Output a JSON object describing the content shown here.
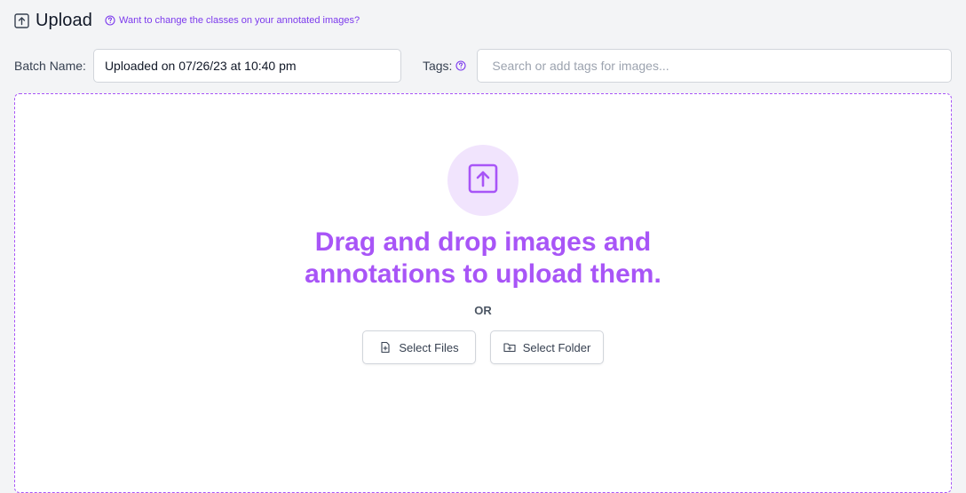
{
  "header": {
    "title": "Upload",
    "title_icon": "upload-square-icon",
    "help_link": "Want to change the classes on your annotated images?",
    "help_icon": "question-circle-icon"
  },
  "batch": {
    "label": "Batch Name:",
    "value": "Uploaded on 07/26/23 at 10:40 pm"
  },
  "tags": {
    "label": "Tags:",
    "help_icon": "question-circle-icon",
    "placeholder": "Search or add tags for images..."
  },
  "dropzone": {
    "icon": "upload-arrow-icon",
    "heading_line1": "Drag and drop images and",
    "heading_line2": "annotations to upload them.",
    "or_text": "OR",
    "select_files_label": "Select Files",
    "select_files_icon": "file-plus-icon",
    "select_folder_label": "Select Folder",
    "select_folder_icon": "folder-plus-icon"
  },
  "colors": {
    "accent": "#a855f7",
    "link": "#7c3aed",
    "icon_bg": "#f1e4fd",
    "page_bg": "#f3f4f6"
  }
}
